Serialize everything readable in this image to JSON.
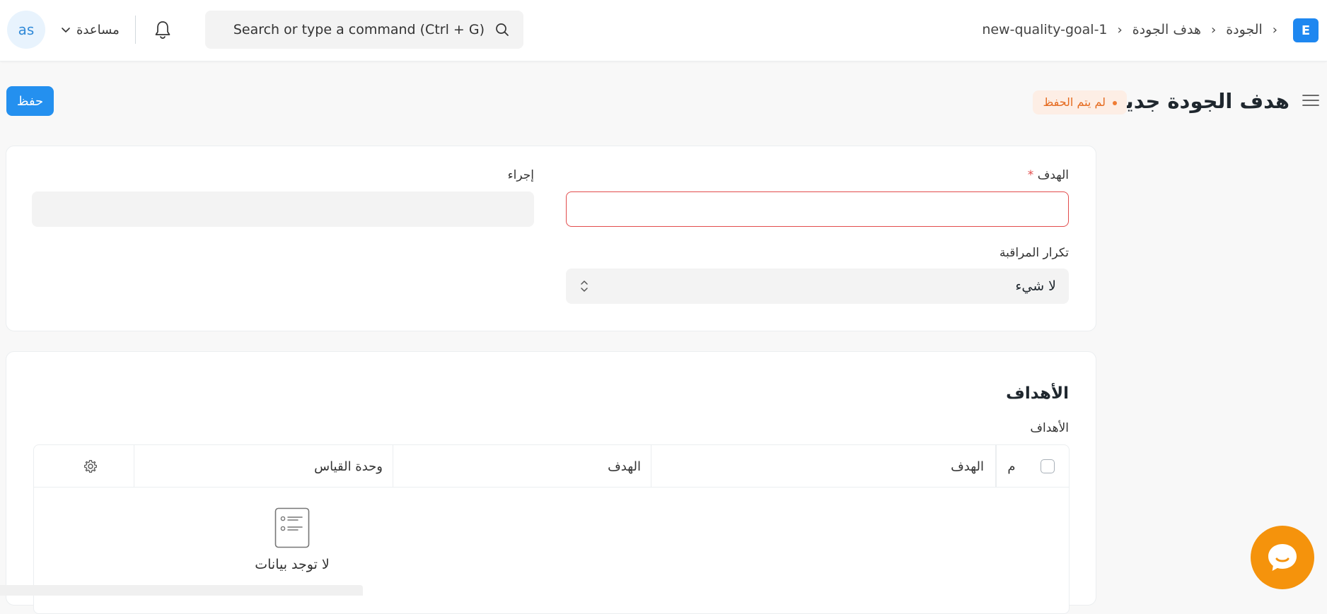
{
  "navbar": {
    "avatar_initials": "as",
    "help_label": "مساعدة",
    "search_placeholder": "Search or type a command (Ctrl + G)",
    "breadcrumbs": [
      "الجودة",
      "هدف الجودة",
      "new-quality-goal-1"
    ],
    "logo_letter": "E"
  },
  "page": {
    "title": "هدف الجودة جديد",
    "status": "لم يتم الحفظ",
    "save_label": "حفظ"
  },
  "form": {
    "goal_label": "الهدف",
    "required_mark": "*",
    "goal_value": "",
    "action_label": "إجراء",
    "action_value": "",
    "frequency_label": "تكرار المراقبة",
    "frequency_value": "لا شيء"
  },
  "objectives": {
    "section_title": "الأهداف",
    "table_label": "الأهداف",
    "columns": {
      "no": "م",
      "objective": "الهدف",
      "target": "الهدف",
      "uom": "وحدة القياس"
    },
    "empty_text": "لا توجد بيانات"
  },
  "colors": {
    "primary": "#2490ef",
    "warning": "#e56a1e",
    "error": "#e24c4c",
    "chat": "#f5930c"
  }
}
